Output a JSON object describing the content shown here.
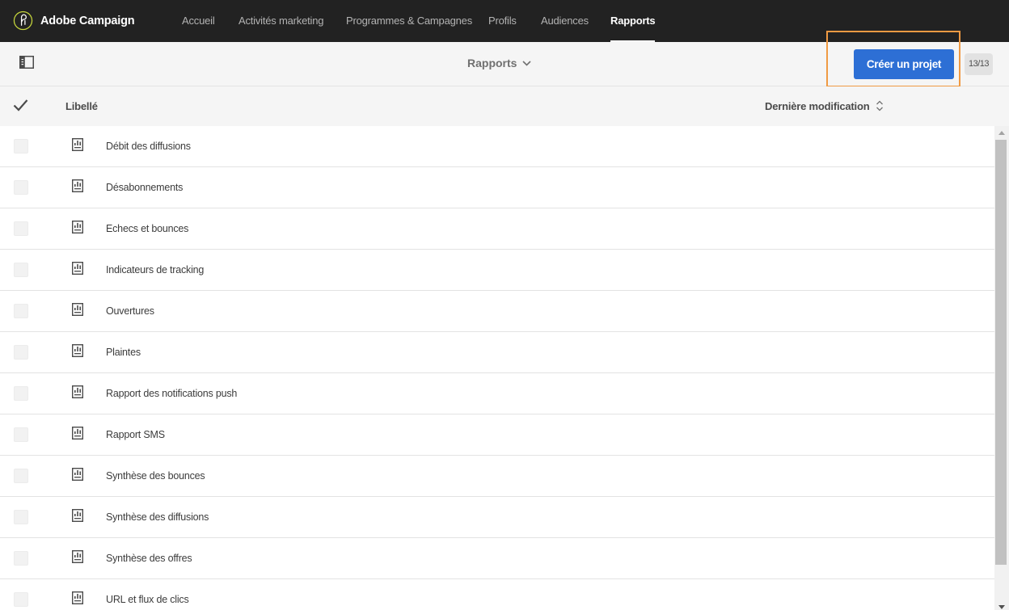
{
  "app": {
    "name": "Adobe Campaign",
    "logo_icon": "adobe-campaign-logo-icon"
  },
  "nav": {
    "items": [
      {
        "label": "Accueil"
      },
      {
        "label": "Activités marketing"
      },
      {
        "label": "Programmes & Campagnes"
      },
      {
        "label": "Profils"
      },
      {
        "label": "Audiences"
      },
      {
        "label": "Rapports"
      }
    ],
    "active": "Rapports"
  },
  "toolbar": {
    "panel_icon": "panel-toggle-icon",
    "view_title": "Rapports",
    "create_label": "Créer un projet",
    "count": "13/13",
    "accent": "#2d6fd5",
    "highlight": "#f09a43"
  },
  "table": {
    "columns": {
      "label": "Libellé",
      "modified": "Dernière modification"
    },
    "rows": [
      {
        "label": "Débit des diffusions"
      },
      {
        "label": "Désabonnements"
      },
      {
        "label": "Echecs et bounces"
      },
      {
        "label": "Indicateurs de tracking"
      },
      {
        "label": "Ouvertures"
      },
      {
        "label": "Plaintes"
      },
      {
        "label": "Rapport des notifications push"
      },
      {
        "label": "Rapport SMS"
      },
      {
        "label": "Synthèse des bounces"
      },
      {
        "label": "Synthèse des diffusions"
      },
      {
        "label": "Synthèse des offres"
      },
      {
        "label": "URL et flux de clics"
      }
    ]
  }
}
